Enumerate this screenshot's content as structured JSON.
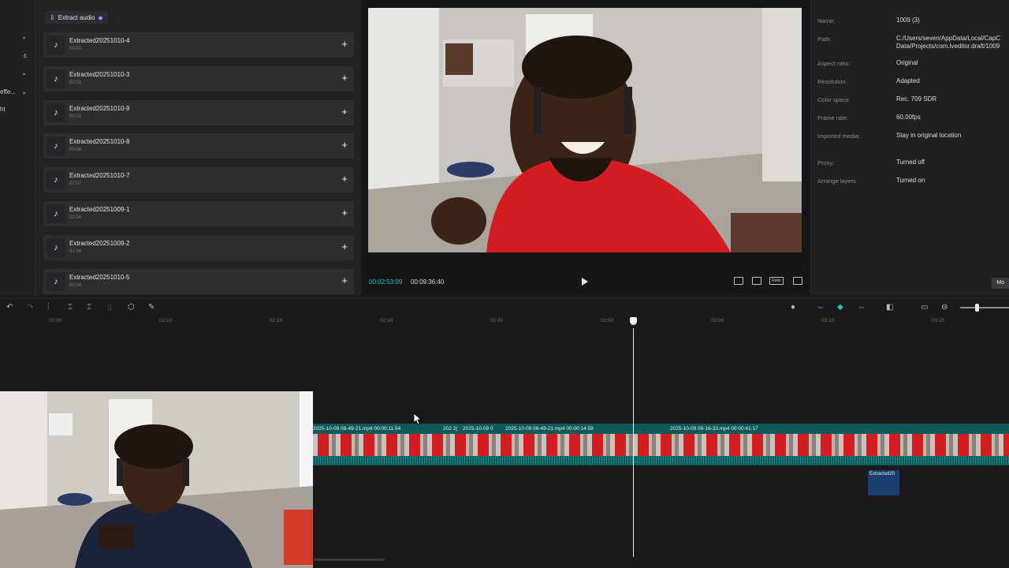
{
  "left_strip": {
    "rows": [
      "",
      "",
      "",
      "effe...",
      "ht"
    ]
  },
  "media": {
    "extract_label": "Extract audio",
    "items": [
      {
        "name": "Extracted20251010-4",
        "duration": "00:03"
      },
      {
        "name": "Extracted20251010-3",
        "duration": "00:01"
      },
      {
        "name": "Extracted20251010-9",
        "duration": "00:01"
      },
      {
        "name": "Extracted20251010-8",
        "duration": "00:06"
      },
      {
        "name": "Extracted20251010-7",
        "duration": "00:07"
      },
      {
        "name": "Extracted20251009-1",
        "duration": "02:54"
      },
      {
        "name": "Extracted20251009-2",
        "duration": "01:04"
      },
      {
        "name": "Extracted20251010-5",
        "duration": "00:04"
      }
    ]
  },
  "preview": {
    "current_time": "00:02:53:09",
    "total_time": "00:09:36:40",
    "ratio_label": "Ratio"
  },
  "properties": {
    "items": [
      {
        "label": "Name:",
        "value": "1009 (3)"
      },
      {
        "label": "Path:",
        "value": "C:/Users/seven/AppData/Local/CapC",
        "value2": "Data/Projects/com.lveditor.draft/1009"
      },
      {
        "label": "Aspect ratio:",
        "value": "Original"
      },
      {
        "label": "Resolution:",
        "value": "Adapted"
      },
      {
        "label": "Color space",
        "value": "Rec. 709 SDR"
      },
      {
        "label": "Frame rate:",
        "value": "60.00fps"
      },
      {
        "label": "Imported media:",
        "value": "Stay in original location"
      },
      {
        "label": "Proxy:",
        "value": "Turned off"
      },
      {
        "label": "Arrange layers",
        "value": "Turned on"
      }
    ],
    "modify_label": "Mo"
  },
  "ruler": {
    "ticks": [
      "02:00",
      "02:10",
      "02:20",
      "02:30",
      "02:40",
      "02:50",
      "03:00",
      "03:10",
      "03:20"
    ]
  },
  "timeline": {
    "clip_labels": [
      {
        "text": "2025-10-09 08-49-21.mp4   00:00:11:54"
      },
      {
        "text": "202  2("
      },
      {
        "text": "2025-10-09 0"
      },
      {
        "text": "2025-10-09 08-49-21.mp4   00:00:14:59"
      },
      {
        "text": "2025-10-09 09-16-33.mp4   00:00:41:17"
      }
    ],
    "audio_clip_label": "Extracted20"
  },
  "colors": {
    "accent": "#1fc5c9",
    "track": "#0f5a58",
    "shirt_red": "#d21e23"
  }
}
